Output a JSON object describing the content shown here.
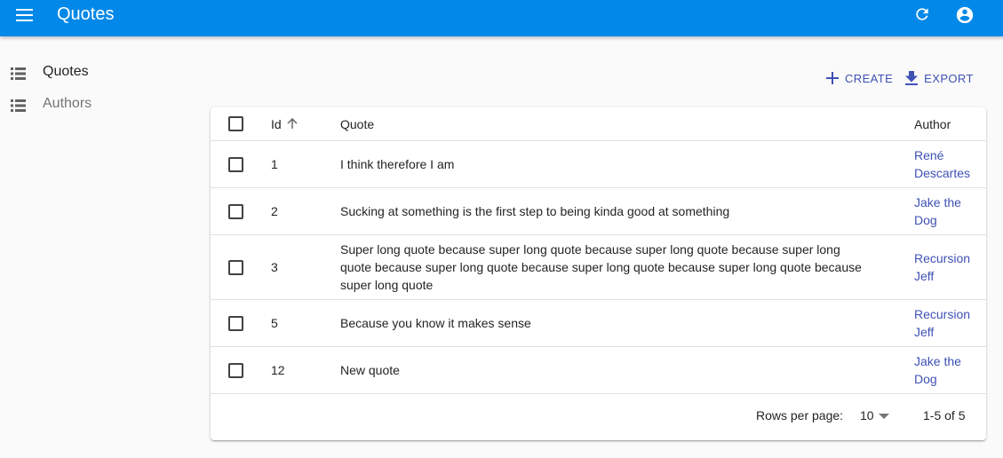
{
  "app": {
    "title": "Quotes"
  },
  "header": {
    "refresh_icon": "refresh-icon",
    "account_icon": "account-circle-icon",
    "menu_icon": "menu-icon"
  },
  "sidebar": {
    "items": [
      {
        "label": "Quotes",
        "icon": "list-icon",
        "active": true
      },
      {
        "label": "Authors",
        "icon": "list-icon",
        "active": false
      }
    ]
  },
  "actions": {
    "create_label": "CREATE",
    "export_label": "EXPORT"
  },
  "table": {
    "headers": {
      "id": "Id",
      "quote": "Quote",
      "author": "Author"
    },
    "rows": [
      {
        "id": "1",
        "quote": "I think therefore I am",
        "author": [
          "René",
          "Descartes"
        ]
      },
      {
        "id": "2",
        "quote": "Sucking at something is the first step to being kinda good at something",
        "author": [
          "Jake the",
          "Dog"
        ]
      },
      {
        "id": "3",
        "quote": [
          "Super long quote because super long quote because super long quote because super long",
          "quote because super long quote because super long quote because super long quote because",
          "super long quote"
        ],
        "author": [
          "Recursion",
          "Jeff"
        ]
      },
      {
        "id": "5",
        "quote": "Because you know it makes sense",
        "author": [
          "Recursion",
          "Jeff"
        ]
      },
      {
        "id": "12",
        "quote": "New quote",
        "author": [
          "Jake the",
          "Dog"
        ]
      }
    ]
  },
  "pagination": {
    "rows_per_page_label": "Rows per page:",
    "rows_per_page_value": "10",
    "range": "1-5 of 5"
  },
  "colors": {
    "appbar": "#0288e8",
    "accent": "#3f51b5"
  }
}
